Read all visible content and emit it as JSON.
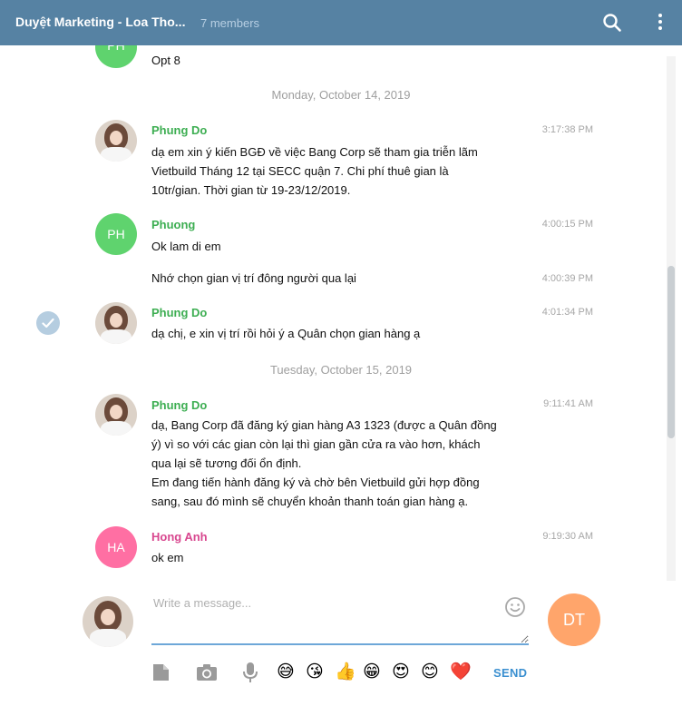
{
  "header": {
    "title": "Duyệt Marketing - Loa Tho...",
    "members": "7 members"
  },
  "history": {
    "top_message": {
      "avatar": "PH",
      "text": "Opt 8"
    },
    "date1": "Monday, October 14, 2019",
    "m1": {
      "name": "Phung Do",
      "time": "3:17:38 PM",
      "text": "dạ em xin ý kiến BGĐ về việc Bang Corp sẽ tham gia triễn lãm\nVietbuild Tháng 12 tại SECC quận 7. Chi phí thuê gian là\n10tr/gian. Thời gian từ 19-23/12/2019."
    },
    "m2": {
      "avatar": "PH",
      "name": "Phuong",
      "time": "4:00:15 PM",
      "text": "Ok lam di em"
    },
    "m3": {
      "time": "4:00:39 PM",
      "text": "Nhớ chọn gian vị trí đông người qua lại"
    },
    "m4": {
      "name": "Phung Do",
      "time": "4:01:34 PM",
      "text": "dạ chị, e xin vị trí rồi hỏi ý a Quân chọn gian hàng ạ"
    },
    "date2": "Tuesday, October 15, 2019",
    "m5": {
      "name": "Phung Do",
      "time": "9:11:41 AM",
      "text": "dạ, Bang Corp đã đăng ký gian hàng A3 1323 (được a Quân đồng\ný) vì so với các gian còn lại thì gian gần cửa ra vào hơn, khách\nqua lại sẽ tương đối ổn định.\nEm đang tiến hành đăng ký và chờ bên Vietbuild gửi hợp đồng\nsang, sau đó mình sẽ chuyển khoản thanh toán gian hàng ạ."
    },
    "m6": {
      "avatar": "HA",
      "name": "Hong Anh",
      "time": "9:19:30 AM",
      "text": "ok em"
    }
  },
  "composer": {
    "placeholder": "Write a message...",
    "dt_avatar": "DT",
    "send_label": "SEND",
    "emojis": [
      "😅",
      "😘",
      "👍",
      "😁",
      "😍",
      "😊",
      "❤️"
    ]
  },
  "colors": {
    "header": "#5682a3",
    "name_green": "#3dae52",
    "name_pink": "#d8478f",
    "avatar_green": "#5fd36e",
    "avatar_pink": "#ff6fa3",
    "avatar_orange": "#ffa56b",
    "send": "#3a8fd0"
  }
}
